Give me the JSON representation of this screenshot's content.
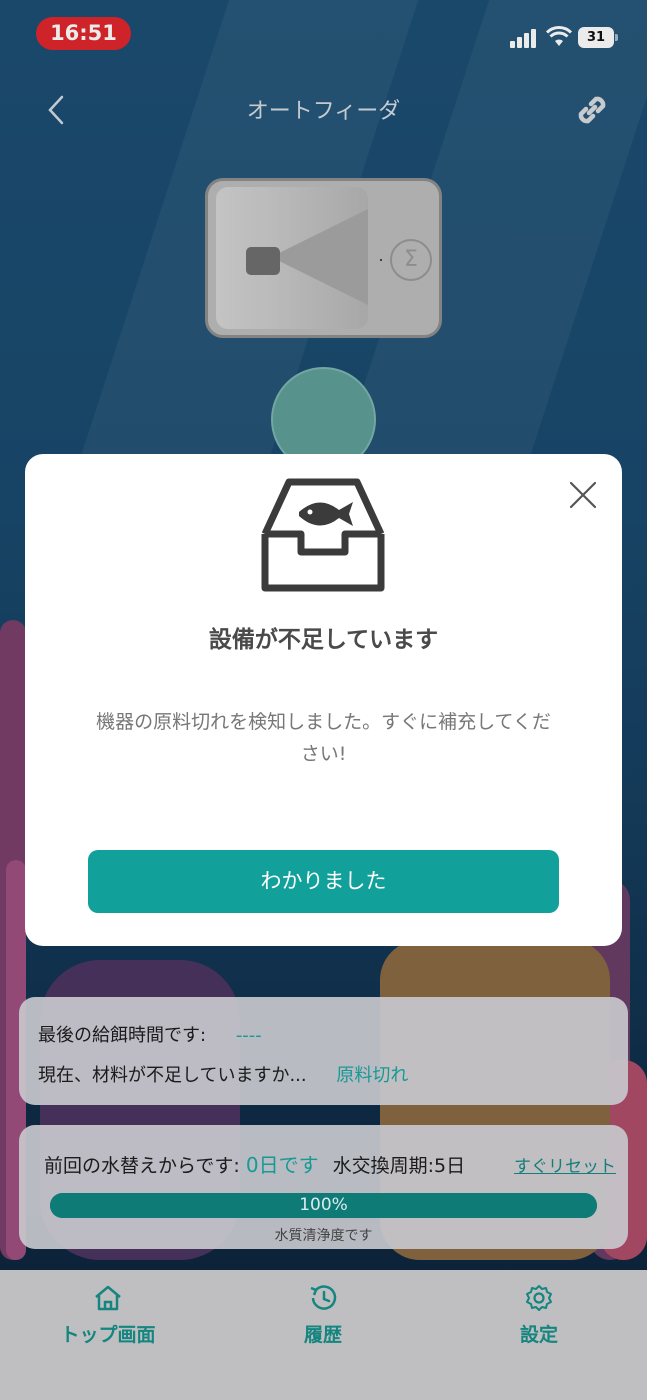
{
  "status_bar": {
    "time": "16:51",
    "battery": "31"
  },
  "header": {
    "title": "オートフィーダ"
  },
  "modal": {
    "title": "設備が不足しています",
    "message": "機器の原料切れを検知しました。すぐに補充してください!",
    "confirm_label": "わかりました"
  },
  "feed_info": {
    "last_feed_label": "最後の給餌時間です:",
    "last_feed_value": "----",
    "material_label": "現在、材料が不足していますか...",
    "material_value": "原料切れ"
  },
  "water_info": {
    "since_label": "前回の水替えからです:",
    "since_value": "0日です",
    "cycle_label": "水交換周期:5日",
    "reset_label": "すぐリセット",
    "quality_percent": 100,
    "quality_text": "100%",
    "quality_caption": "水質清浄度です"
  },
  "tabs": [
    {
      "label": "トップ画面",
      "icon": "home-icon"
    },
    {
      "label": "履歴",
      "icon": "history-icon"
    },
    {
      "label": "設定",
      "icon": "gear-icon"
    }
  ],
  "colors": {
    "accent": "#12a09b",
    "alert": "#e0262c"
  }
}
